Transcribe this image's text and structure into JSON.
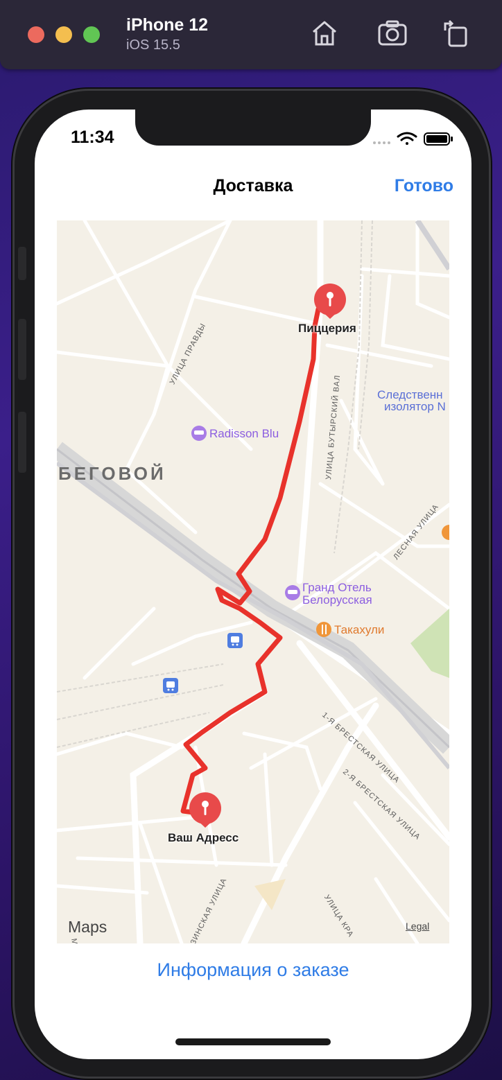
{
  "simulator": {
    "device_name": "iPhone 12",
    "os_version": "iOS 15.5",
    "toolbar_icons": [
      "home-icon",
      "screenshot-icon",
      "rotate-icon"
    ]
  },
  "status_bar": {
    "time": "11:34",
    "icons": [
      "cellular-dots-icon",
      "wifi-icon",
      "battery-icon"
    ]
  },
  "navigation": {
    "title": "Доставка",
    "done_label": "Готово"
  },
  "map": {
    "district": "БЕГОВОЙ",
    "streets": {
      "pravdy": "УЛИЦА ПРАВДЫ",
      "butyrsky": "УЛИЦА БУТЫРСКИЙ ВАЛ",
      "lesnaya": "ЛЕСНАЯ УЛИЦА",
      "brest1": "1-Я БРЕСТСКАЯ УЛИЦА",
      "brest2": "2-Я БРЕСТСКАЯ УЛИЦА",
      "gruzinskaya": "ЗИНСКАЯ УЛИЦА",
      "krasina": "УЛИЦА КРА",
      "left_edge": "МАЛ"
    },
    "pois": {
      "radisson": "Radisson Blu",
      "grand_hotel_line1": "Гранд Отель",
      "grand_hotel_line2": "Белорусская",
      "takahuli": "Такахули",
      "sizo_line1": "Следственн",
      "sizo_line2": "изолятор N"
    },
    "pins": {
      "origin": "Пиццерия",
      "destination": "Ваш Адресс"
    },
    "attribution": "Maps",
    "legal": "Legal",
    "route_color": "#e8322b"
  },
  "footer": {
    "order_info_label": "Информация о заказе"
  },
  "colors": {
    "accent": "#2f7ce6",
    "map_background": "#f4f0e7",
    "pin": "#e84a4a"
  }
}
